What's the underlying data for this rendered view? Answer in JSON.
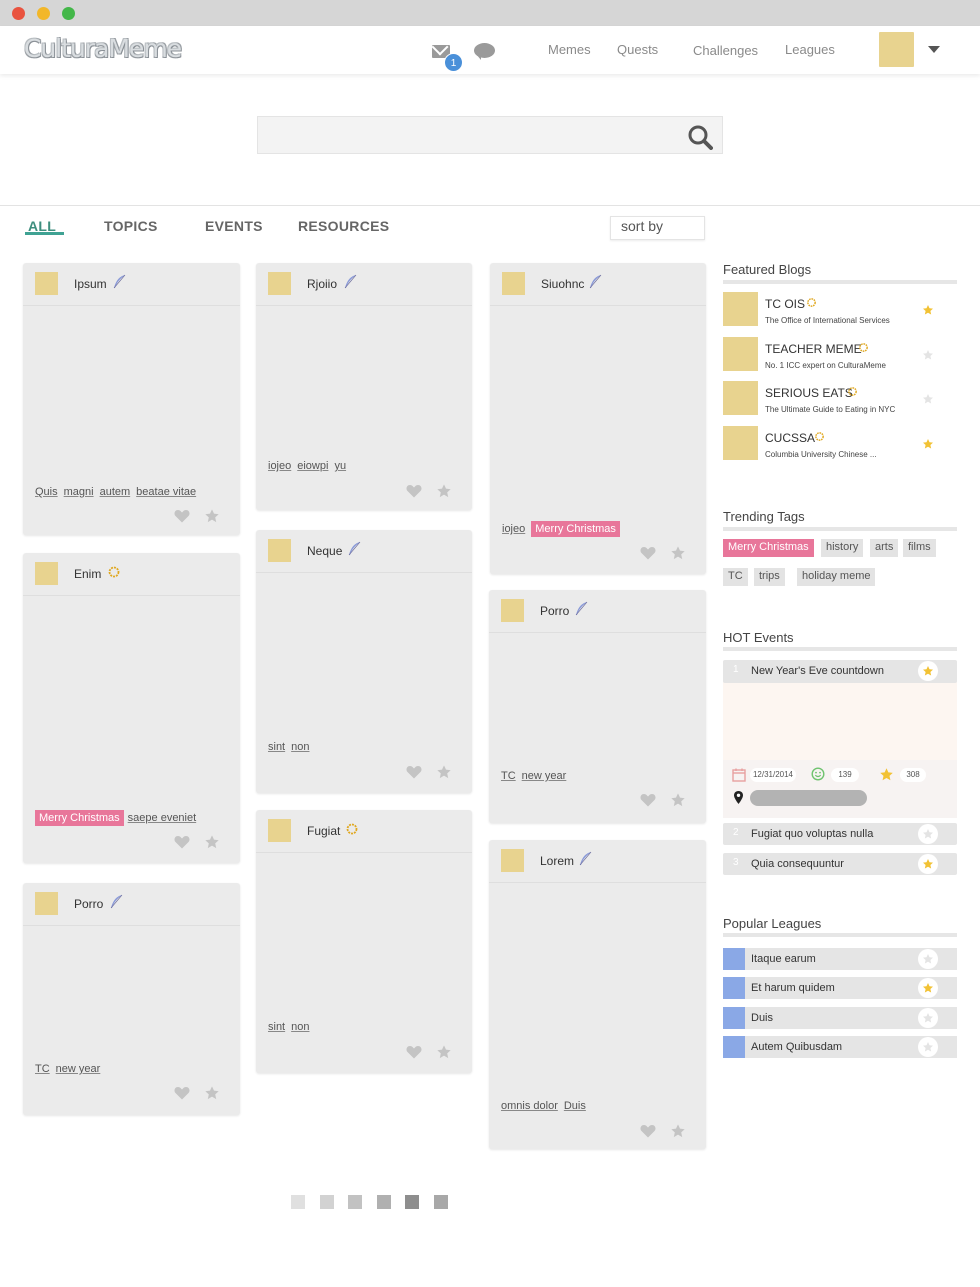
{
  "app": {
    "logo": "CulturaMeme"
  },
  "header": {
    "mail_badge": "1",
    "nav": [
      "Memes",
      "Quests",
      "Challenges",
      "Leagues"
    ]
  },
  "search": {
    "placeholder": ""
  },
  "tabs": [
    "ALL",
    "TOPICS",
    "EVENTS",
    "RESOURCES"
  ],
  "sort_label": "sort by",
  "cards": [
    {
      "name": "Ipsum",
      "badge": "feather-icon",
      "tags": [
        "Quis",
        "magni",
        "autem",
        "beatae vitae"
      ],
      "pink_tag": ""
    },
    {
      "name": "Enim",
      "badge": "sun-badge-icon",
      "tags": [
        "saepe eveniet"
      ],
      "pink_tag": "Merry Christmas"
    },
    {
      "name": "Porro",
      "badge": "feather-icon",
      "tags": [
        "TC",
        "new year"
      ],
      "pink_tag": ""
    },
    {
      "name": "Rjoiio",
      "badge": "feather-icon",
      "tags": [
        "iojeo",
        "eiowpi",
        "yu"
      ],
      "pink_tag": ""
    },
    {
      "name": "Neque",
      "badge": "feather-icon",
      "tags": [
        "sint",
        "non"
      ],
      "pink_tag": ""
    },
    {
      "name": "Fugiat",
      "badge": "sun-badge-icon",
      "tags": [
        "sint",
        "non"
      ],
      "pink_tag": ""
    },
    {
      "name": "Siuohnc",
      "badge": "feather-icon",
      "tags": [
        "iojeo"
      ],
      "pink_tag": "Merry Christmas"
    },
    {
      "name": "Porro",
      "badge": "feather-icon",
      "tags": [
        "TC",
        "new year"
      ],
      "pink_tag": ""
    },
    {
      "name": "Lorem",
      "badge": "feather-icon",
      "tags": [
        "omnis dolor",
        "Duis"
      ],
      "pink_tag": ""
    }
  ],
  "featured_blogs": {
    "title": "Featured Blogs",
    "items": [
      {
        "name": "TC OIS",
        "sub": "The Office of International Services",
        "starred": true
      },
      {
        "name": "TEACHER MEME",
        "sub": "No. 1 ICC expert on CulturaMeme",
        "starred": false
      },
      {
        "name": "SERIOUS EATS",
        "sub": "The Ultimate Guide to Eating in NYC",
        "starred": false
      },
      {
        "name": "CUCSSA",
        "sub": "Columbia University Chinese ...",
        "starred": true
      }
    ]
  },
  "trending_tags": {
    "title": "Trending Tags",
    "items": [
      "Merry Christmas",
      "history",
      "arts",
      "films",
      "TC",
      "trips",
      "holiday meme"
    ]
  },
  "hot_events": {
    "title": "HOT Events",
    "items": [
      {
        "num": "1",
        "name": "New Year's Eve countdown",
        "starred": true
      },
      {
        "num": "2",
        "name": "Fugiat quo voluptas nulla",
        "starred": false
      },
      {
        "num": "3",
        "name": "Quia consequuntur",
        "starred": true
      }
    ],
    "detail": {
      "date": "12/31/2014",
      "smiles": "139",
      "stars": "308"
    }
  },
  "popular_leagues": {
    "title": "Popular Leagues",
    "items": [
      {
        "name": "Itaque earum",
        "starred": false
      },
      {
        "name": "Et harum quidem",
        "starred": true
      },
      {
        "name": "Duis",
        "starred": false
      },
      {
        "name": "Autem Quibusdam",
        "starred": false
      }
    ]
  },
  "colors": {
    "accent": "#3fa293",
    "pink": "#e8769a",
    "gold": "#f2c234",
    "avatar": "#e8d38f",
    "league": "#8aa8e6"
  },
  "pagination": {
    "pages": 6,
    "current": 5
  }
}
